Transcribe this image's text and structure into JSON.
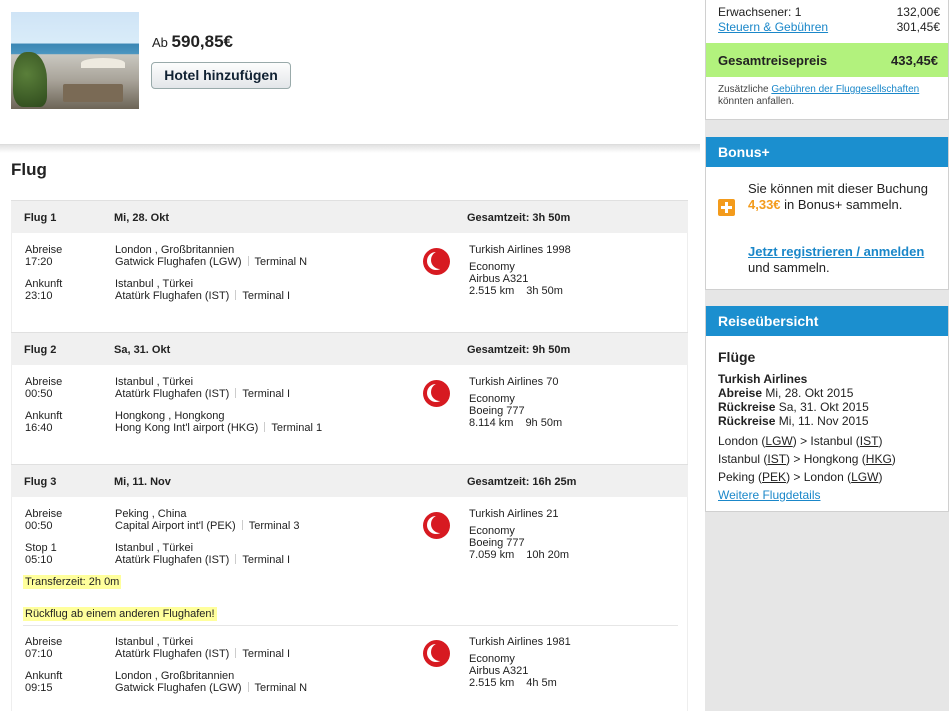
{
  "hotel": {
    "price_prefix": "Ab",
    "price": "590,85€",
    "add_button": "Hotel hinzufügen"
  },
  "section_title": "Flug",
  "flights": [
    {
      "label": "Flug 1",
      "date": "Mi, 28. Okt",
      "total_time": "Gesamtzeit: 3h 50m",
      "segments": [
        {
          "dep_label": "Abreise",
          "dep_time": "17:20",
          "dep_city": "London , Großbritannien",
          "dep_airport": "Gatwick Flughafen (LGW)",
          "dep_terminal": "Terminal N",
          "arr_label": "Ankunft",
          "arr_time": "23:10",
          "arr_city": "Istanbul , Türkei",
          "arr_airport": "Atatürk Flughafen (IST)",
          "arr_terminal": "Terminal I",
          "airline": "Turkish Airlines 1998",
          "cabin": "Economy",
          "aircraft": "Airbus A321",
          "distance": "2.515 km",
          "duration": "3h 50m"
        }
      ]
    },
    {
      "label": "Flug 2",
      "date": "Sa, 31. Okt",
      "total_time": "Gesamtzeit: 9h 50m",
      "segments": [
        {
          "dep_label": "Abreise",
          "dep_time": "00:50",
          "dep_city": "Istanbul , Türkei",
          "dep_airport": "Atatürk Flughafen (IST)",
          "dep_terminal": "Terminal I",
          "arr_label": "Ankunft",
          "arr_time": "16:40",
          "arr_city": "Hongkong , Hongkong",
          "arr_airport": "Hong Kong Int'l airport (HKG)",
          "arr_terminal": "Terminal 1",
          "airline": "Turkish Airlines 70",
          "cabin": "Economy",
          "aircraft": "Boeing 777",
          "distance": "8.114 km",
          "duration": "9h 50m"
        }
      ]
    },
    {
      "label": "Flug 3",
      "date": "Mi, 11. Nov",
      "total_time": "Gesamtzeit: 16h 25m",
      "transfer_note": "Transferzeit: 2h 0m",
      "airport_note": "Rückflug ab einem anderen Flughafen!",
      "segments": [
        {
          "dep_label": "Abreise",
          "dep_time": "00:50",
          "dep_city": "Peking , China",
          "dep_airport": "Capital Airport int'l (PEK)",
          "dep_terminal": "Terminal 3",
          "arr_label": "Stop 1",
          "arr_time": "05:10",
          "arr_city": "Istanbul , Türkei",
          "arr_airport": "Atatürk Flughafen (IST)",
          "arr_terminal": "Terminal I",
          "airline": "Turkish Airlines 21",
          "cabin": "Economy",
          "aircraft": "Boeing 777",
          "distance": "7.059 km",
          "duration": "10h 20m"
        },
        {
          "dep_label": "Abreise",
          "dep_time": "07:10",
          "dep_city": "Istanbul , Türkei",
          "dep_airport": "Atatürk Flughafen (IST)",
          "dep_terminal": "Terminal I",
          "arr_label": "Ankunft",
          "arr_time": "09:15",
          "arr_city": "London , Großbritannien",
          "arr_airport": "Gatwick Flughafen (LGW)",
          "arr_terminal": "Terminal N",
          "airline": "Turkish Airlines 1981",
          "cabin": "Economy",
          "aircraft": "Airbus A321",
          "distance": "2.515 km",
          "duration": "4h 5m"
        }
      ]
    }
  ],
  "price_panel": {
    "adults_label": "Erwachsener: 1",
    "adults_amount": "132,00€",
    "taxes_label": "Steuern & Gebühren",
    "taxes_amount": "301,45€",
    "total_label": "Gesamtreisepreis",
    "total_amount": "433,45€",
    "note_prefix": "Zusätzliche ",
    "note_link": "Gebühren der Fluggesellschaften",
    "note_suffix": " könnten anfallen."
  },
  "bonus_panel": {
    "title": "Bonus+",
    "text_prefix": "Sie können mit dieser Buchung ",
    "amount": "4,33€",
    "text_suffix": " in Bonus+ sammeln.",
    "link": "Jetzt registrieren / anmelden",
    "link_suffix": "und sammeln."
  },
  "summary_panel": {
    "title": "Reiseübersicht",
    "heading": "Flüge",
    "airline": "Turkish Airlines",
    "dep_label": "Abreise",
    "dep_date": "Mi, 28. Okt 2015",
    "ret_label": "Rückreise",
    "ret_date": "Sa, 31. Okt 2015",
    "ret2_label": "Rückreise",
    "ret2_date": "Mi, 11. Nov 2015",
    "routes": [
      {
        "from_city": "London",
        "from_code": "LGW",
        "to_city": "Istanbul",
        "to_code": "IST"
      },
      {
        "from_city": "Istanbul",
        "from_code": "IST",
        "to_city": "Hongkong",
        "to_code": "HKG"
      },
      {
        "from_city": "Peking",
        "from_code": "PEK",
        "to_city": "London",
        "to_code": "LGW"
      }
    ],
    "more_link": "Weitere Flugdetails"
  },
  "colors": {
    "accent": "#1b8fcf",
    "total_bar": "#b2f27d",
    "bonus": "#f39b1c",
    "airline_red": "#d71a21",
    "highlight": "#ffff9c"
  }
}
